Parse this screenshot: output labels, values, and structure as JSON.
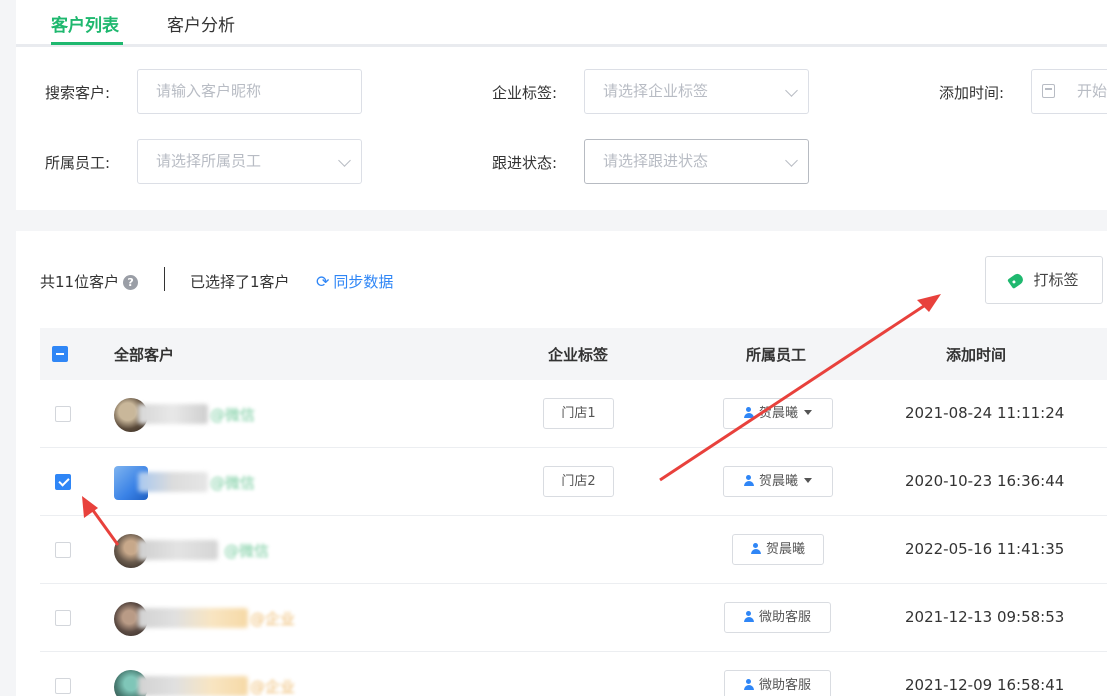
{
  "tabs": [
    {
      "label": "客户列表",
      "active": true
    },
    {
      "label": "客户分析",
      "active": false
    }
  ],
  "filters": {
    "search_label": "搜索客户:",
    "search_placeholder": "请输入客户昵称",
    "enterprise_tag_label": "企业标签:",
    "enterprise_tag_placeholder": "请选择企业标签",
    "add_time_label": "添加时间:",
    "add_time_placeholder": "开始",
    "staff_label": "所属员工:",
    "staff_placeholder": "请选择所属员工",
    "follow_label": "跟进状态:",
    "follow_placeholder": "请选择跟进状态"
  },
  "summary": {
    "total": "共11位客户",
    "help_icon": "?",
    "selected": "已选择了1客户",
    "sync_icon": "⟳",
    "sync": "同步数据",
    "tag_button": "打标签"
  },
  "table": {
    "columns": [
      "全部客户",
      "企业标签",
      "所属员工",
      "添加时间"
    ],
    "rows": [
      {
        "checked": false,
        "name": "@微信",
        "tag": "门店1",
        "staff": "贺晨曦",
        "staff_dropdown": true,
        "time": "2021-08-24 11:11:24"
      },
      {
        "checked": true,
        "name": "@微信",
        "tag": "门店2",
        "staff": "贺晨曦",
        "staff_dropdown": true,
        "time": "2020-10-23 16:36:44"
      },
      {
        "checked": false,
        "name": "@微信",
        "tag": "",
        "staff": "贺晨曦",
        "staff_dropdown": false,
        "time": "2022-05-16 11:41:35"
      },
      {
        "checked": false,
        "name": "@企业",
        "tag": "",
        "staff": "微助客服",
        "staff_dropdown": false,
        "time": "2021-12-13 09:58:53"
      },
      {
        "checked": false,
        "name": "@企业",
        "tag": "",
        "staff": "微助客服",
        "staff_dropdown": false,
        "time": "2021-12-09 16:58:41"
      }
    ]
  },
  "colors": {
    "accent_green": "#1fb86f",
    "accent_blue": "#2f86f6",
    "arrow_red": "#e8413c"
  }
}
